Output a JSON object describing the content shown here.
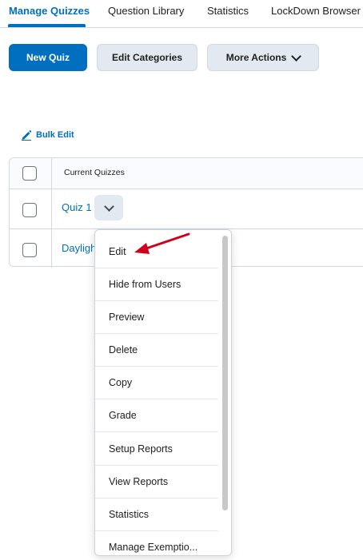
{
  "tabs": [
    {
      "label": "Manage Quizzes",
      "active": true
    },
    {
      "label": "Question Library"
    },
    {
      "label": "Statistics"
    },
    {
      "label": "LockDown Browser"
    }
  ],
  "toolbar": {
    "new_quiz": "New Quiz",
    "edit_categories": "Edit Categories",
    "more_actions": "More Actions"
  },
  "bulk_edit": "Bulk Edit",
  "table": {
    "header": "Current Quizzes",
    "rows": [
      {
        "name": "Quiz 1"
      },
      {
        "name": "Daylight"
      }
    ]
  },
  "menu": {
    "items": [
      "Edit",
      "Hide from Users",
      "Preview",
      "Delete",
      "Copy",
      "Grade",
      "Setup Reports",
      "View Reports",
      "Statistics",
      "Manage Exemptio..."
    ]
  },
  "colors": {
    "accent": "#006fbf",
    "secondary_button": "#e3e9f1",
    "annotation_arrow": "#d0021b"
  }
}
